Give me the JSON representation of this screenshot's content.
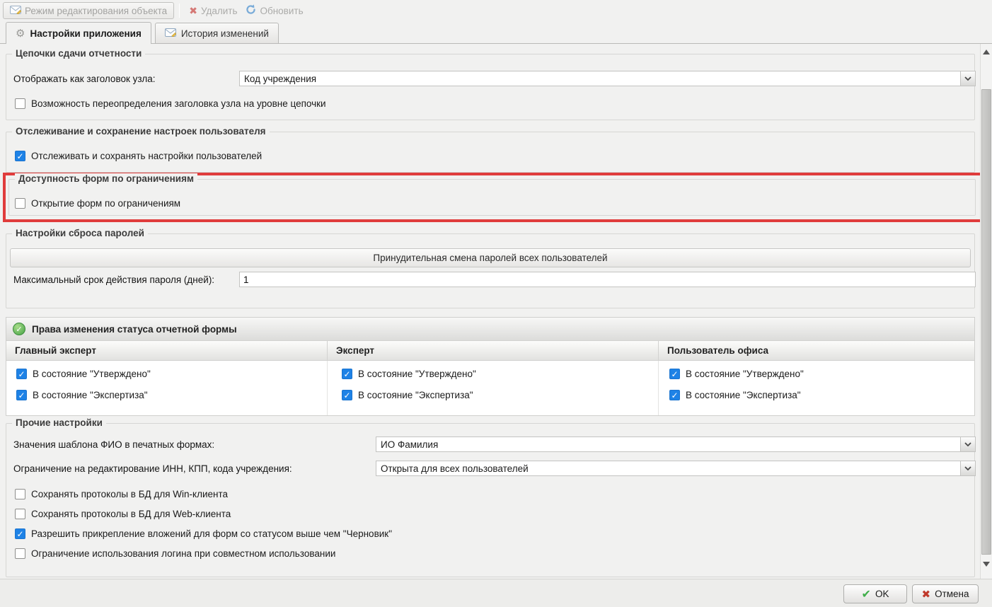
{
  "toolbar": {
    "edit_mode": "Режим редактирования объекта",
    "delete": "Удалить",
    "refresh": "Обновить"
  },
  "tabs": {
    "app_settings": "Настройки приложения",
    "history": "История изменений"
  },
  "chains": {
    "title": "Цепочки сдачи отчетности",
    "node_header_label": "Отображать как заголовок узла:",
    "node_header_value": "Код учреждения",
    "override": {
      "label": "Возможность переопределения заголовка узла на уровне цепочки",
      "checked": false
    }
  },
  "tracking": {
    "title": "Отслеживание и сохранение настроек пользователя",
    "track": {
      "label": "Отслеживать и сохранять настройки пользователей",
      "checked": true
    }
  },
  "restrictions": {
    "title": "Доступность форм по ограничениям",
    "open_forms": {
      "label": "Открытие форм по ограничениям",
      "checked": false
    },
    "highlight_color": "#e03c3c"
  },
  "password": {
    "title": "Настройки сброса паролей",
    "force_change": "Принудительная смена паролей всех пользователей",
    "max_age_label": "Максимальный срок действия пароля (дней):",
    "max_age_value": "1"
  },
  "status_rights": {
    "title": "Права изменения статуса отчетной формы",
    "columns": [
      {
        "header": "Главный эксперт",
        "options": [
          {
            "label": "В состояние \"Утверждено\"",
            "checked": true
          },
          {
            "label": "В состояние \"Экспертиза\"",
            "checked": true
          }
        ]
      },
      {
        "header": "Эксперт",
        "options": [
          {
            "label": "В состояние \"Утверждено\"",
            "checked": true
          },
          {
            "label": "В состояние \"Экспертиза\"",
            "checked": true
          }
        ]
      },
      {
        "header": "Пользователь офиса",
        "options": [
          {
            "label": "В состояние \"Утверждено\"",
            "checked": true
          },
          {
            "label": "В состояние \"Экспертиза\"",
            "checked": true
          }
        ]
      }
    ]
  },
  "other": {
    "title": "Прочие настройки",
    "fio_label": "Значения шаблона ФИО в печатных формах:",
    "fio_value": "ИО Фамилия",
    "inn_label": "Ограничение на редактирование ИНН, КПП, кода учреждения:",
    "inn_value": "Открыта для всех пользователей",
    "win_protocols": {
      "label": "Сохранять протоколы в БД для Win-клиента",
      "checked": false
    },
    "web_protocols": {
      "label": "Сохранять протоколы в БД для Web-клиента",
      "checked": false
    },
    "attachments": {
      "label": "Разрешить прикрепление вложений для форм со статусом выше чем \"Черновик\"",
      "checked": true
    },
    "login_restriction": {
      "label": "Ограничение использования логина при совместном использовании",
      "checked": false
    }
  },
  "footer": {
    "ok": "OK",
    "cancel": "Отмена"
  },
  "colors": {
    "checkbox_checked": "#1e82e6",
    "highlight_border": "#e03c3c",
    "ok_icon": "#3fae49",
    "cancel_icon": "#c0392b"
  }
}
